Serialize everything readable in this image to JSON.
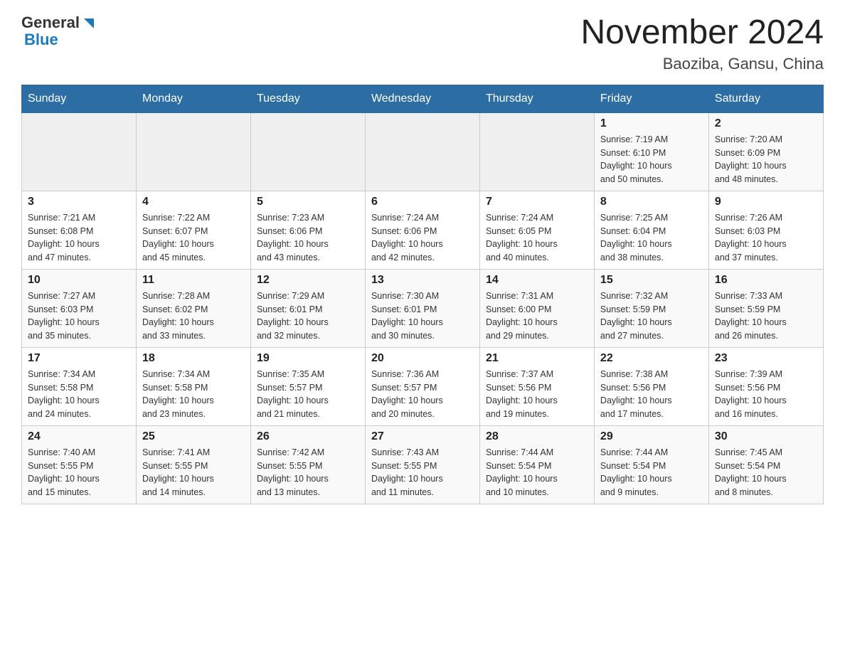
{
  "header": {
    "logo_general": "General",
    "logo_blue": "Blue",
    "title": "November 2024",
    "subtitle": "Baoziba, Gansu, China"
  },
  "weekdays": [
    "Sunday",
    "Monday",
    "Tuesday",
    "Wednesday",
    "Thursday",
    "Friday",
    "Saturday"
  ],
  "weeks": [
    [
      {
        "day": "",
        "info": ""
      },
      {
        "day": "",
        "info": ""
      },
      {
        "day": "",
        "info": ""
      },
      {
        "day": "",
        "info": ""
      },
      {
        "day": "",
        "info": ""
      },
      {
        "day": "1",
        "info": "Sunrise: 7:19 AM\nSunset: 6:10 PM\nDaylight: 10 hours\nand 50 minutes."
      },
      {
        "day": "2",
        "info": "Sunrise: 7:20 AM\nSunset: 6:09 PM\nDaylight: 10 hours\nand 48 minutes."
      }
    ],
    [
      {
        "day": "3",
        "info": "Sunrise: 7:21 AM\nSunset: 6:08 PM\nDaylight: 10 hours\nand 47 minutes."
      },
      {
        "day": "4",
        "info": "Sunrise: 7:22 AM\nSunset: 6:07 PM\nDaylight: 10 hours\nand 45 minutes."
      },
      {
        "day": "5",
        "info": "Sunrise: 7:23 AM\nSunset: 6:06 PM\nDaylight: 10 hours\nand 43 minutes."
      },
      {
        "day": "6",
        "info": "Sunrise: 7:24 AM\nSunset: 6:06 PM\nDaylight: 10 hours\nand 42 minutes."
      },
      {
        "day": "7",
        "info": "Sunrise: 7:24 AM\nSunset: 6:05 PM\nDaylight: 10 hours\nand 40 minutes."
      },
      {
        "day": "8",
        "info": "Sunrise: 7:25 AM\nSunset: 6:04 PM\nDaylight: 10 hours\nand 38 minutes."
      },
      {
        "day": "9",
        "info": "Sunrise: 7:26 AM\nSunset: 6:03 PM\nDaylight: 10 hours\nand 37 minutes."
      }
    ],
    [
      {
        "day": "10",
        "info": "Sunrise: 7:27 AM\nSunset: 6:03 PM\nDaylight: 10 hours\nand 35 minutes."
      },
      {
        "day": "11",
        "info": "Sunrise: 7:28 AM\nSunset: 6:02 PM\nDaylight: 10 hours\nand 33 minutes."
      },
      {
        "day": "12",
        "info": "Sunrise: 7:29 AM\nSunset: 6:01 PM\nDaylight: 10 hours\nand 32 minutes."
      },
      {
        "day": "13",
        "info": "Sunrise: 7:30 AM\nSunset: 6:01 PM\nDaylight: 10 hours\nand 30 minutes."
      },
      {
        "day": "14",
        "info": "Sunrise: 7:31 AM\nSunset: 6:00 PM\nDaylight: 10 hours\nand 29 minutes."
      },
      {
        "day": "15",
        "info": "Sunrise: 7:32 AM\nSunset: 5:59 PM\nDaylight: 10 hours\nand 27 minutes."
      },
      {
        "day": "16",
        "info": "Sunrise: 7:33 AM\nSunset: 5:59 PM\nDaylight: 10 hours\nand 26 minutes."
      }
    ],
    [
      {
        "day": "17",
        "info": "Sunrise: 7:34 AM\nSunset: 5:58 PM\nDaylight: 10 hours\nand 24 minutes."
      },
      {
        "day": "18",
        "info": "Sunrise: 7:34 AM\nSunset: 5:58 PM\nDaylight: 10 hours\nand 23 minutes."
      },
      {
        "day": "19",
        "info": "Sunrise: 7:35 AM\nSunset: 5:57 PM\nDaylight: 10 hours\nand 21 minutes."
      },
      {
        "day": "20",
        "info": "Sunrise: 7:36 AM\nSunset: 5:57 PM\nDaylight: 10 hours\nand 20 minutes."
      },
      {
        "day": "21",
        "info": "Sunrise: 7:37 AM\nSunset: 5:56 PM\nDaylight: 10 hours\nand 19 minutes."
      },
      {
        "day": "22",
        "info": "Sunrise: 7:38 AM\nSunset: 5:56 PM\nDaylight: 10 hours\nand 17 minutes."
      },
      {
        "day": "23",
        "info": "Sunrise: 7:39 AM\nSunset: 5:56 PM\nDaylight: 10 hours\nand 16 minutes."
      }
    ],
    [
      {
        "day": "24",
        "info": "Sunrise: 7:40 AM\nSunset: 5:55 PM\nDaylight: 10 hours\nand 15 minutes."
      },
      {
        "day": "25",
        "info": "Sunrise: 7:41 AM\nSunset: 5:55 PM\nDaylight: 10 hours\nand 14 minutes."
      },
      {
        "day": "26",
        "info": "Sunrise: 7:42 AM\nSunset: 5:55 PM\nDaylight: 10 hours\nand 13 minutes."
      },
      {
        "day": "27",
        "info": "Sunrise: 7:43 AM\nSunset: 5:55 PM\nDaylight: 10 hours\nand 11 minutes."
      },
      {
        "day": "28",
        "info": "Sunrise: 7:44 AM\nSunset: 5:54 PM\nDaylight: 10 hours\nand 10 minutes."
      },
      {
        "day": "29",
        "info": "Sunrise: 7:44 AM\nSunset: 5:54 PM\nDaylight: 10 hours\nand 9 minutes."
      },
      {
        "day": "30",
        "info": "Sunrise: 7:45 AM\nSunset: 5:54 PM\nDaylight: 10 hours\nand 8 minutes."
      }
    ]
  ]
}
